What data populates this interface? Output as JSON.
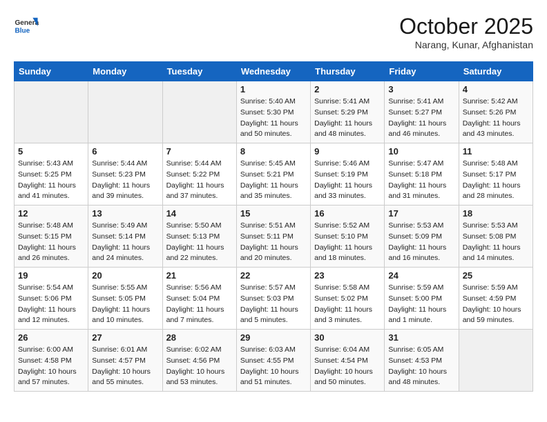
{
  "header": {
    "logo_general": "General",
    "logo_blue": "Blue",
    "month": "October 2025",
    "location": "Narang, Kunar, Afghanistan"
  },
  "days_of_week": [
    "Sunday",
    "Monday",
    "Tuesday",
    "Wednesday",
    "Thursday",
    "Friday",
    "Saturday"
  ],
  "weeks": [
    {
      "cells": [
        {
          "day": "",
          "empty": true
        },
        {
          "day": "",
          "empty": true
        },
        {
          "day": "",
          "empty": true
        },
        {
          "day": "1",
          "sunrise": "5:40 AM",
          "sunset": "5:30 PM",
          "daylight": "11 hours and 50 minutes."
        },
        {
          "day": "2",
          "sunrise": "5:41 AM",
          "sunset": "5:29 PM",
          "daylight": "11 hours and 48 minutes."
        },
        {
          "day": "3",
          "sunrise": "5:41 AM",
          "sunset": "5:27 PM",
          "daylight": "11 hours and 46 minutes."
        },
        {
          "day": "4",
          "sunrise": "5:42 AM",
          "sunset": "5:26 PM",
          "daylight": "11 hours and 43 minutes."
        }
      ]
    },
    {
      "cells": [
        {
          "day": "5",
          "sunrise": "5:43 AM",
          "sunset": "5:25 PM",
          "daylight": "11 hours and 41 minutes."
        },
        {
          "day": "6",
          "sunrise": "5:44 AM",
          "sunset": "5:23 PM",
          "daylight": "11 hours and 39 minutes."
        },
        {
          "day": "7",
          "sunrise": "5:44 AM",
          "sunset": "5:22 PM",
          "daylight": "11 hours and 37 minutes."
        },
        {
          "day": "8",
          "sunrise": "5:45 AM",
          "sunset": "5:21 PM",
          "daylight": "11 hours and 35 minutes."
        },
        {
          "day": "9",
          "sunrise": "5:46 AM",
          "sunset": "5:19 PM",
          "daylight": "11 hours and 33 minutes."
        },
        {
          "day": "10",
          "sunrise": "5:47 AM",
          "sunset": "5:18 PM",
          "daylight": "11 hours and 31 minutes."
        },
        {
          "day": "11",
          "sunrise": "5:48 AM",
          "sunset": "5:17 PM",
          "daylight": "11 hours and 28 minutes."
        }
      ]
    },
    {
      "cells": [
        {
          "day": "12",
          "sunrise": "5:48 AM",
          "sunset": "5:15 PM",
          "daylight": "11 hours and 26 minutes."
        },
        {
          "day": "13",
          "sunrise": "5:49 AM",
          "sunset": "5:14 PM",
          "daylight": "11 hours and 24 minutes."
        },
        {
          "day": "14",
          "sunrise": "5:50 AM",
          "sunset": "5:13 PM",
          "daylight": "11 hours and 22 minutes."
        },
        {
          "day": "15",
          "sunrise": "5:51 AM",
          "sunset": "5:11 PM",
          "daylight": "11 hours and 20 minutes."
        },
        {
          "day": "16",
          "sunrise": "5:52 AM",
          "sunset": "5:10 PM",
          "daylight": "11 hours and 18 minutes."
        },
        {
          "day": "17",
          "sunrise": "5:53 AM",
          "sunset": "5:09 PM",
          "daylight": "11 hours and 16 minutes."
        },
        {
          "day": "18",
          "sunrise": "5:53 AM",
          "sunset": "5:08 PM",
          "daylight": "11 hours and 14 minutes."
        }
      ]
    },
    {
      "cells": [
        {
          "day": "19",
          "sunrise": "5:54 AM",
          "sunset": "5:06 PM",
          "daylight": "11 hours and 12 minutes."
        },
        {
          "day": "20",
          "sunrise": "5:55 AM",
          "sunset": "5:05 PM",
          "daylight": "11 hours and 10 minutes."
        },
        {
          "day": "21",
          "sunrise": "5:56 AM",
          "sunset": "5:04 PM",
          "daylight": "11 hours and 7 minutes."
        },
        {
          "day": "22",
          "sunrise": "5:57 AM",
          "sunset": "5:03 PM",
          "daylight": "11 hours and 5 minutes."
        },
        {
          "day": "23",
          "sunrise": "5:58 AM",
          "sunset": "5:02 PM",
          "daylight": "11 hours and 3 minutes."
        },
        {
          "day": "24",
          "sunrise": "5:59 AM",
          "sunset": "5:00 PM",
          "daylight": "11 hours and 1 minute."
        },
        {
          "day": "25",
          "sunrise": "5:59 AM",
          "sunset": "4:59 PM",
          "daylight": "10 hours and 59 minutes."
        }
      ]
    },
    {
      "cells": [
        {
          "day": "26",
          "sunrise": "6:00 AM",
          "sunset": "4:58 PM",
          "daylight": "10 hours and 57 minutes."
        },
        {
          "day": "27",
          "sunrise": "6:01 AM",
          "sunset": "4:57 PM",
          "daylight": "10 hours and 55 minutes."
        },
        {
          "day": "28",
          "sunrise": "6:02 AM",
          "sunset": "4:56 PM",
          "daylight": "10 hours and 53 minutes."
        },
        {
          "day": "29",
          "sunrise": "6:03 AM",
          "sunset": "4:55 PM",
          "daylight": "10 hours and 51 minutes."
        },
        {
          "day": "30",
          "sunrise": "6:04 AM",
          "sunset": "4:54 PM",
          "daylight": "10 hours and 50 minutes."
        },
        {
          "day": "31",
          "sunrise": "6:05 AM",
          "sunset": "4:53 PM",
          "daylight": "10 hours and 48 minutes."
        },
        {
          "day": "",
          "empty": true
        }
      ]
    }
  ]
}
